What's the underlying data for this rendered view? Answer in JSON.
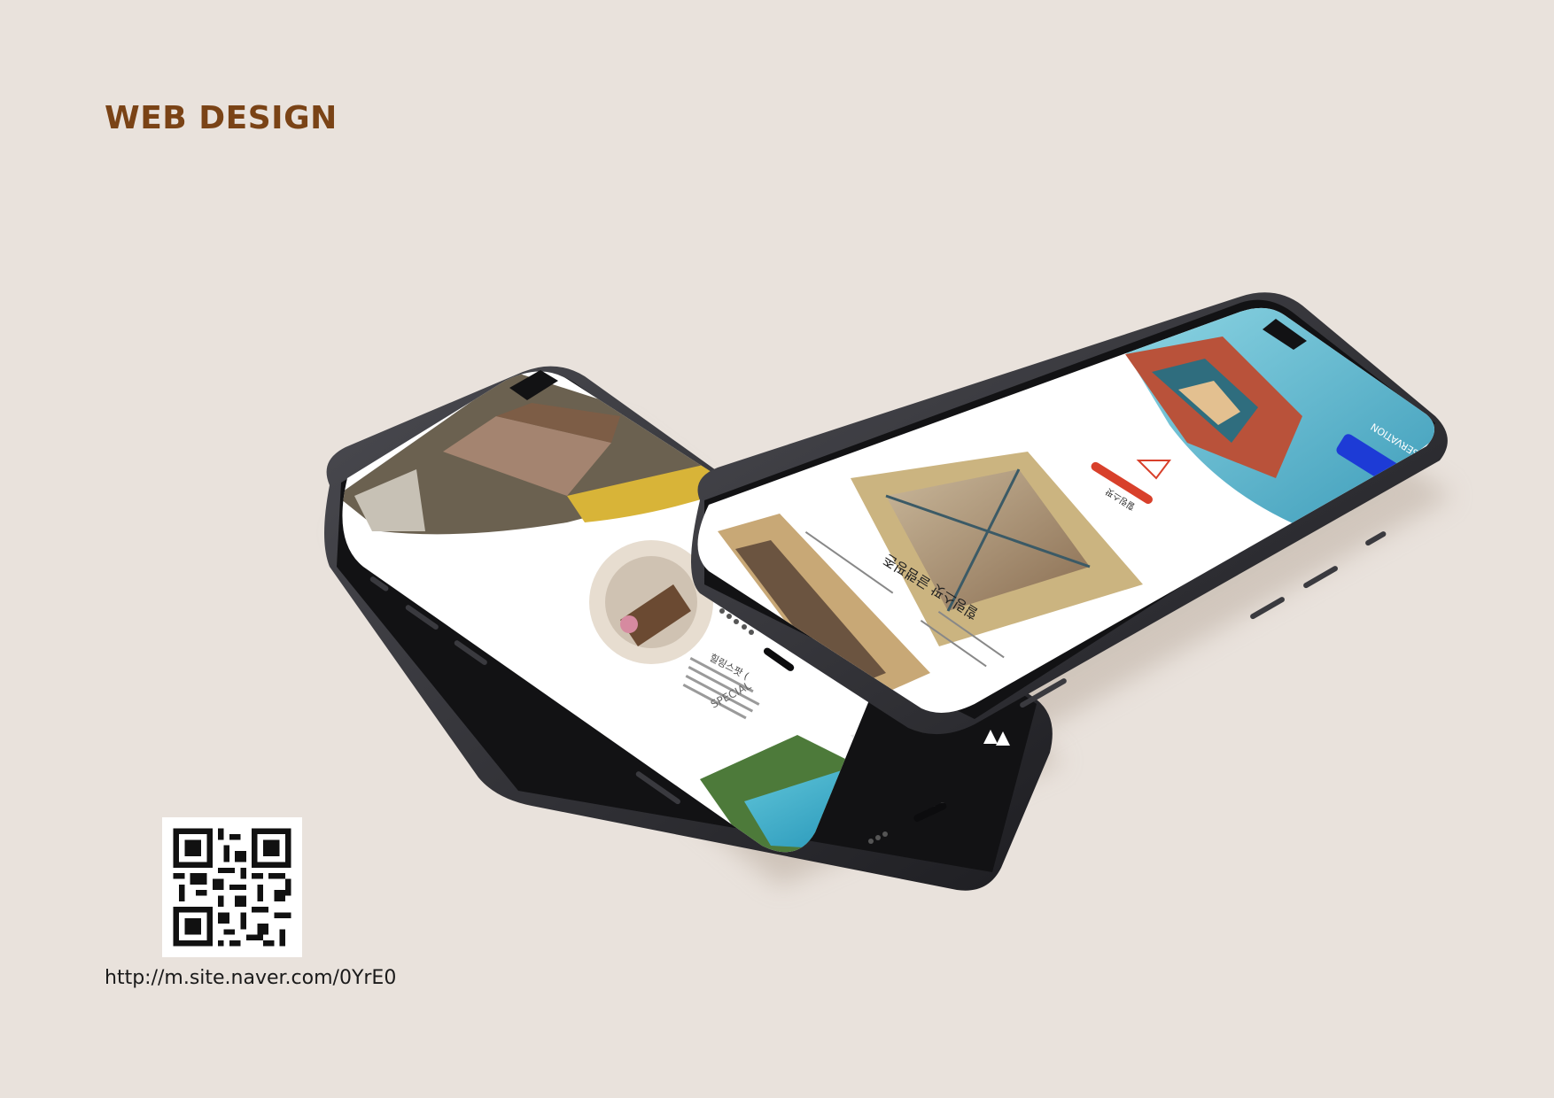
{
  "page": {
    "title": "WEB DESIGN",
    "qr_url": "http://m.site.naver.com/0YrE0"
  },
  "phone_left": {
    "screen_texts": [
      "힐링스팟 (",
      "SPECIAL"
    ]
  },
  "phone_right": {
    "button": "RESERVATION",
    "heading": "힐링스팟 글램핑존",
    "logo_text": "힐링스팟"
  },
  "colors": {
    "title": "#7a4316",
    "background": "#e9e2dc",
    "phone_frame": "#2b2b2f",
    "accent_red": "#d8402b",
    "accent_blue": "#1d3bd6"
  },
  "icons": [
    "qr-code-icon",
    "tree-icon"
  ]
}
